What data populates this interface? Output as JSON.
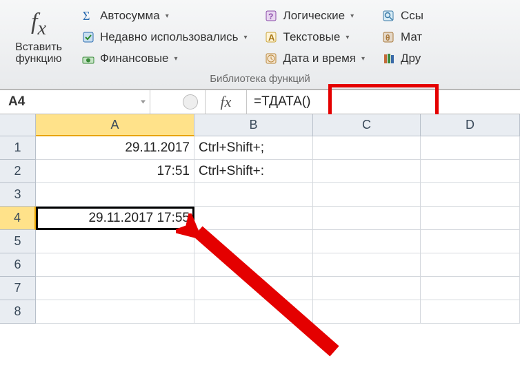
{
  "ribbon": {
    "insert_function": {
      "label": "Вставить\nфункцию"
    },
    "autosum": "Автосумма",
    "recent": "Недавно использовались",
    "financial": "Финансовые",
    "logical": "Логические",
    "text": "Текстовые",
    "date_time": "Дата и время",
    "lookup": "Ссы",
    "math": "Мат",
    "other": "Дру",
    "group_label": "Библиотека функций"
  },
  "formula_bar": {
    "name_box": "A4",
    "fx_label": "fx",
    "formula": "=ТДАТА()"
  },
  "columns": [
    "A",
    "B",
    "C",
    "D"
  ],
  "rows": [
    {
      "n": 1,
      "A": "29.11.2017",
      "B": "Ctrl+Shift+;"
    },
    {
      "n": 2,
      "A": "17:51",
      "B": "Ctrl+Shift+:"
    },
    {
      "n": 3,
      "A": "",
      "B": ""
    },
    {
      "n": 4,
      "A": "29.11.2017 17:55",
      "B": ""
    },
    {
      "n": 5,
      "A": "",
      "B": ""
    },
    {
      "n": 6,
      "A": "",
      "B": ""
    },
    {
      "n": 7,
      "A": "",
      "B": ""
    },
    {
      "n": 8,
      "A": "",
      "B": ""
    }
  ],
  "selected": {
    "cell": "A4",
    "row": 4,
    "col": "A"
  }
}
